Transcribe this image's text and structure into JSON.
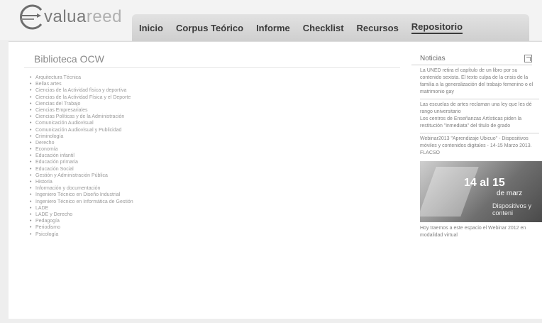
{
  "brand": {
    "name_dark": "valua",
    "name_light": "reed"
  },
  "nav": {
    "items": [
      {
        "label": "Inicio"
      },
      {
        "label": "Corpus Teórico"
      },
      {
        "label": "Informe"
      },
      {
        "label": "Checklist"
      },
      {
        "label": "Recursos"
      },
      {
        "label": "Repositorio"
      }
    ]
  },
  "main": {
    "title": "Biblioteca OCW",
    "items": [
      "Arquitectura Técnica",
      "Bellas artes",
      "Ciencias de la Actividad física y deportiva",
      "Ciencias de la Actividad Física y el Deporte",
      "Ciencias del Trabajo",
      "Ciencias Empresariales",
      "Ciencias Políticas y de la Administración",
      "Comunicación Audiovisual",
      "Comunicación Audiovisual y Publicidad",
      "Criminología",
      "Derecho",
      "Economía",
      "Educación infantil",
      "Educación primaria",
      "Educación Social",
      "Gestión y Administración Pública",
      "Historia",
      "Información y documentación",
      "Ingeniero Técnico en Diseño Industrial",
      "Ingeniero Técnico en Informática de Gestión",
      "LADE",
      "LADE y Derecho",
      "Pedagogía",
      "Periodismo",
      "Psicología"
    ]
  },
  "sidebar": {
    "title": "Noticias",
    "news": [
      "La UNED retira el capítulo de un libro por su contenido sexista. El texto culpa de la crisis de la familia a la generalización del trabajo femenino o el matrimonio gay",
      "Las escuelas de artes reclaman una ley que les dé rango universitario",
      "Los centros de Enseñanzas Artísticas piden la restitución \"inmediata\" del título de grado",
      "Webinar2013 \"Aprendizaje Ubicuo\" - Dispositivos móviles y contenidos digitales - 14-15 Marzo 2013. FLACSO"
    ],
    "banner": {
      "line1": "14 al 15",
      "line2": "de marz",
      "line3": "Dispositivos y conteni"
    },
    "last_news": "Hoy traemos a este espacio el Webinar 2012 en modalidad virtual"
  },
  "icons": {
    "logo": "valuareed-logo-icon",
    "expand": "external-link-icon"
  }
}
